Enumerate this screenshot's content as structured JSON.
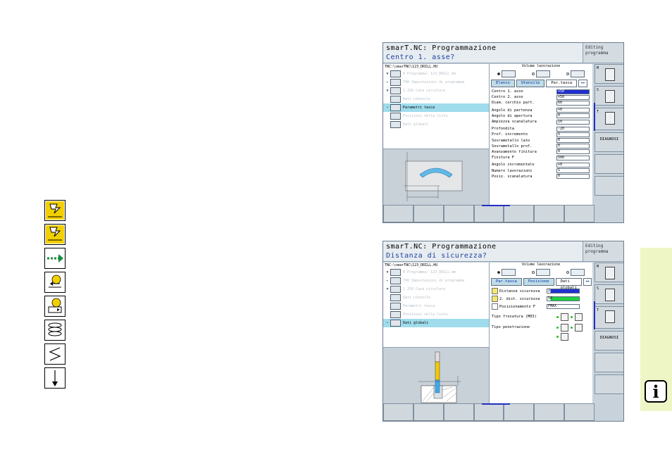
{
  "left_icons": [
    "drill-icon",
    "drill-icon",
    "rapid-arrow-icon",
    "approach-icon",
    "retract-icon",
    "helix-icon",
    "zigzag-icon",
    "plunge-arrow-icon"
  ],
  "screen1": {
    "header_line1": "smarT.NC: Programmazione",
    "header_line2": "Centro 1. asse?",
    "mode": "Editing programma",
    "path": "TNC:\\smarTNC\\123_DRILL.HU",
    "tree": [
      {
        "exp": "▼",
        "label": "0  Programma: 123_DRILL  mm",
        "selected": false
      },
      {
        "exp": "▸",
        "label": "700 Impostazioni di programma",
        "selected": false
      },
      {
        "exp": "▼",
        "label": "1 256 Cava circolare",
        "selected": false
      },
      {
        "exp": "",
        "label": "Dati utensile",
        "selected": false
      },
      {
        "exp": "•",
        "label": "Parametri tasca",
        "selected": true
      },
      {
        "exp": "",
        "label": "Posizioni nella lista",
        "selected": false
      },
      {
        "exp": "",
        "label": "Dati globali",
        "selected": false
      }
    ],
    "volume_label": "Volume lavorazione",
    "tabs": [
      "Elenco",
      "Utensile",
      "Par.tasca",
      "◂▸"
    ],
    "fields": [
      {
        "label": "Centro 1. asse",
        "value": "+50",
        "hl": true,
        "gap": false
      },
      {
        "label": "Centro 2. asse",
        "value": "+50",
        "hl": false,
        "gap": false
      },
      {
        "label": "Diam. cerchio part.",
        "value": "60",
        "hl": false,
        "gap": false
      },
      {
        "label": "Angolo di partenza",
        "value": "+0",
        "hl": false,
        "gap": true
      },
      {
        "label": "Angolo di apertura",
        "value": "0",
        "hl": false,
        "gap": false
      },
      {
        "label": "Ampiezza scanalatura",
        "value": "10",
        "hl": false,
        "gap": false
      },
      {
        "label": "Profondita",
        "value": "-20",
        "hl": false,
        "gap": true
      },
      {
        "label": "Prof. incremento",
        "value": "5",
        "hl": false,
        "gap": false
      },
      {
        "label": "Sovrametallo lato",
        "value": "0",
        "hl": false,
        "gap": false
      },
      {
        "label": "Sovrametallo prof.",
        "value": "0",
        "hl": false,
        "gap": false
      },
      {
        "label": "Avanzamento finitura",
        "value": "0",
        "hl": false,
        "gap": false
      },
      {
        "label": "Finitura F",
        "value": "500",
        "hl": false,
        "gap": false
      },
      {
        "label": "Angolo incrementale",
        "value": "+0",
        "hl": false,
        "gap": true
      },
      {
        "label": "Numero lavorazioni",
        "value": "1",
        "hl": false,
        "gap": false
      },
      {
        "label": "Posiz. scanalatura",
        "value": "0",
        "hl": false,
        "gap": false
      }
    ]
  },
  "screen2": {
    "header_line1": "smarT.NC: Programmazione",
    "header_line2": "Distanza di sicurezza?",
    "mode": "Editing programma",
    "path": "TNC:\\smarTNC\\123_DRILL.HU",
    "tree": [
      {
        "exp": "▼",
        "label": "0  Programma: 123_DRILL  mm",
        "selected": false
      },
      {
        "exp": "▸",
        "label": "700 Impostazioni di programma",
        "selected": false
      },
      {
        "exp": "▼",
        "label": "1 256 Cava circolare",
        "selected": false
      },
      {
        "exp": "",
        "label": "Dati utensile",
        "selected": false
      },
      {
        "exp": "",
        "label": "Parametri tasca",
        "selected": false
      },
      {
        "exp": "",
        "label": "Posizioni nella lista",
        "selected": false
      },
      {
        "exp": "•",
        "label": "Dati globali",
        "selected": true
      }
    ],
    "volume_label": "Volume lavorazione",
    "tabs": [
      "Par.tasca",
      "Posizione",
      "Dati globali",
      "◂▸"
    ],
    "fields": [
      {
        "label": "Distanza sicurezza",
        "value": "2"
      },
      {
        "label": "2. dist. sicurezza",
        "value": "50"
      },
      {
        "label": "Posizionamento F",
        "value": "FMAX"
      }
    ],
    "option1_label": "Tipo fresatura (M03)",
    "option2_label": "Tipo penetrazione"
  },
  "side": {
    "m_label": "M",
    "s_label": "S",
    "t_label": "T",
    "diag_label": "DIAGNOSI"
  },
  "info_glyph": "i"
}
